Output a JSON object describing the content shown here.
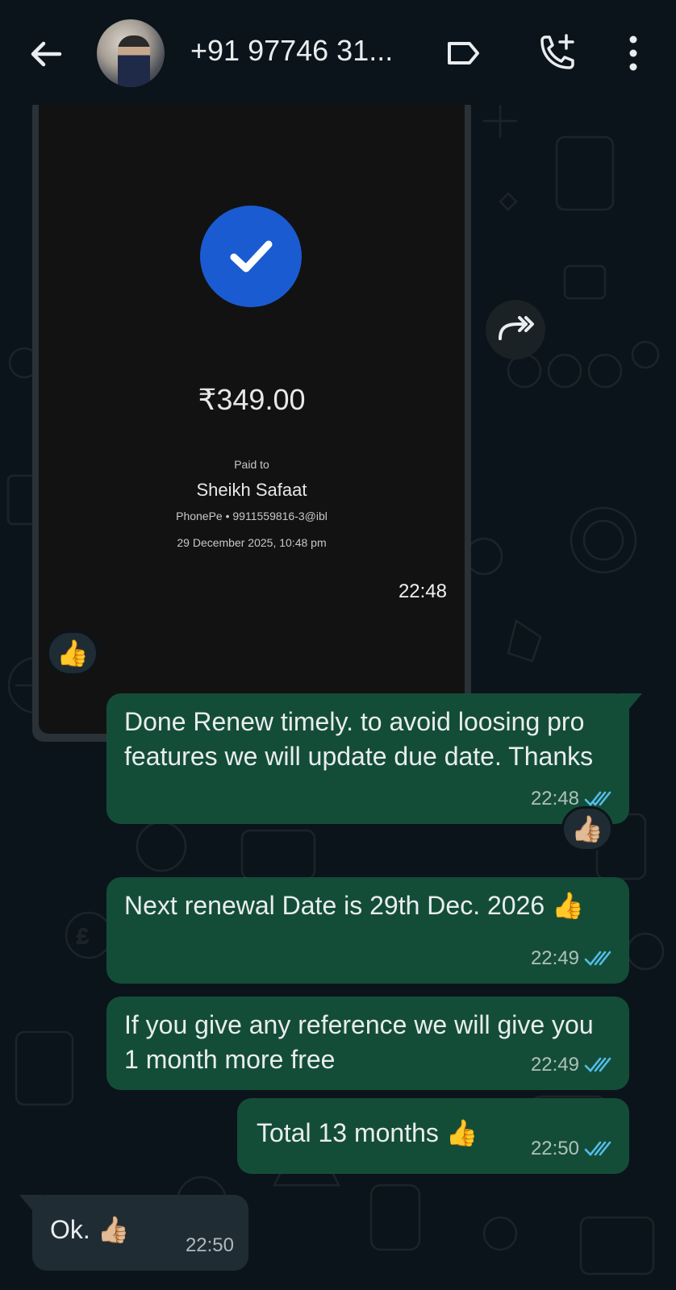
{
  "header": {
    "title": "+91 97746 31...",
    "back_icon": "arrow-left-icon",
    "label_icon": "label-icon",
    "call_icon": "add-call-icon",
    "menu_icon": "more-vert-icon"
  },
  "payment_receipt": {
    "amount": "₹349.00",
    "paid_to_label": "Paid to",
    "payee_name": "Sheikh Safaat",
    "upi_line": "PhonePe • 9911559816-3@ibl",
    "date_line": "29 December 2025, 10:48 pm",
    "time": "22:48"
  },
  "reactions": {
    "on_receipt": "👍",
    "on_message_1": "👍🏼"
  },
  "messages": [
    {
      "direction": "out",
      "text": "Done Renew timely. to avoid loosing pro features we will update due date. Thanks",
      "time": "22:48",
      "status": "read"
    },
    {
      "direction": "out",
      "text": "Next renewal Date is 29th Dec. 2026 👍",
      "time": "22:49",
      "status": "read"
    },
    {
      "direction": "out",
      "text": "If you give any reference we will give you 1 month more free",
      "time": "22:49",
      "status": "read"
    },
    {
      "direction": "out",
      "text": "Total 13 months 👍",
      "time": "22:50",
      "status": "read"
    },
    {
      "direction": "in",
      "text": "Ok. 👍🏼",
      "time": "22:50"
    }
  ],
  "colors": {
    "background": "#0b141a",
    "outgoing_bubble": "#144d37",
    "incoming_bubble": "#202c33",
    "read_ticks": "#53bdeb",
    "check_circle": "#1a5bd1"
  }
}
